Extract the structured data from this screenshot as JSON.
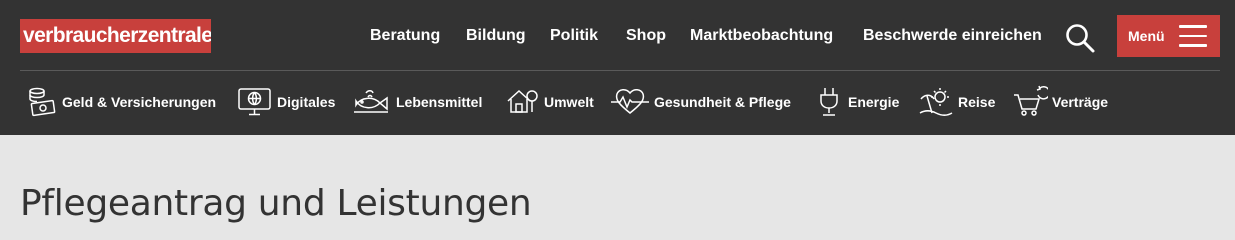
{
  "brand": {
    "logo_text": "verbraucherzentrale",
    "color": "#c8403c"
  },
  "topnav": {
    "items": [
      {
        "label": "Beratung"
      },
      {
        "label": "Bildung"
      },
      {
        "label": "Politik"
      },
      {
        "label": "Shop"
      },
      {
        "label": "Marktbeobachtung"
      },
      {
        "label": "Beschwerde einreichen"
      }
    ]
  },
  "search": {
    "icon": "search-icon"
  },
  "menu": {
    "label": "Menü",
    "icon": "hamburger-icon"
  },
  "categories": [
    {
      "label": "Geld & Versicherungen",
      "icon": "money-coins-icon"
    },
    {
      "label": "Digitales",
      "icon": "monitor-globe-icon"
    },
    {
      "label": "Lebensmittel",
      "icon": "fish-icon"
    },
    {
      "label": "Umwelt",
      "icon": "house-tree-icon"
    },
    {
      "label": "Gesundheit & Pflege",
      "icon": "heartbeat-icon"
    },
    {
      "label": "Energie",
      "icon": "plug-icon"
    },
    {
      "label": "Reise",
      "icon": "beach-sun-icon"
    },
    {
      "label": "Verträge",
      "icon": "shopping-cart-icon"
    }
  ],
  "page": {
    "title": "Pflegeantrag und Leistungen"
  },
  "colors": {
    "header_bg": "#333333",
    "page_bg": "#e6e6e6",
    "accent": "#c8403c"
  }
}
